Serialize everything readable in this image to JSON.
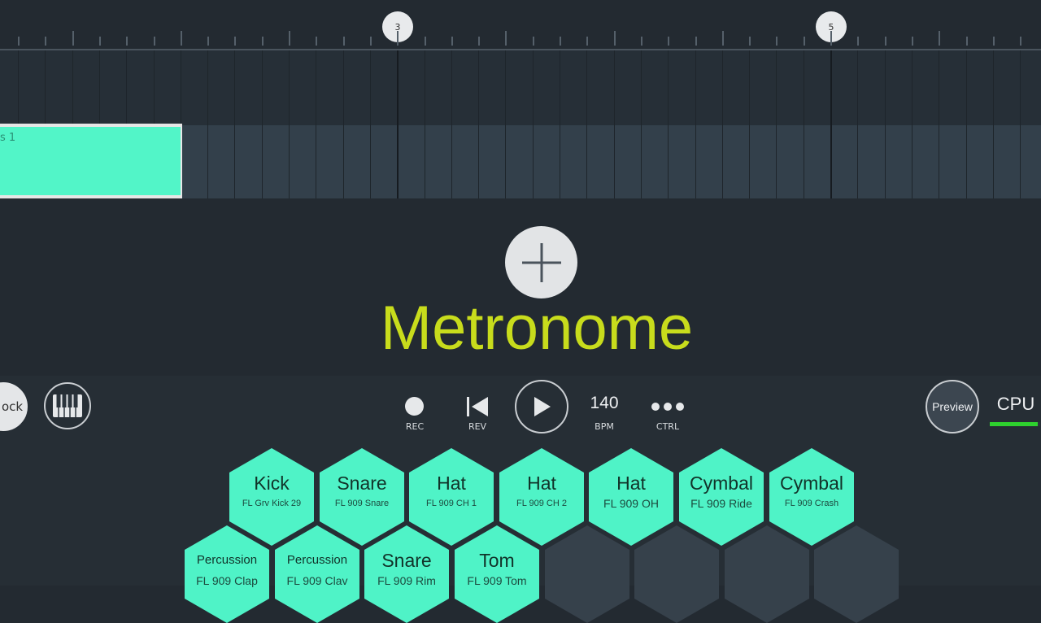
{
  "timeline": {
    "markers": [
      "3",
      "5"
    ]
  },
  "playlist": {
    "pattern_clip_label": "s 1"
  },
  "overlay": {
    "title": "Metronome"
  },
  "left_controls": {
    "lock_label": "ock"
  },
  "transport": {
    "rec_label": "REC",
    "rev_label": "REV",
    "bpm_value": "140",
    "bpm_label": "BPM",
    "ctrl_label": "CTRL"
  },
  "right_controls": {
    "preview_label": "Preview",
    "cpu_label": "CPU",
    "cpu_level": 0.95,
    "cpu_color": "#2ed12e"
  },
  "pads": {
    "row1": [
      {
        "name": "Kick",
        "sample": "FL Grv Kick 29"
      },
      {
        "name": "Snare",
        "sample": "FL 909 Snare"
      },
      {
        "name": "Hat",
        "sample": "FL 909 CH 1"
      },
      {
        "name": "Hat",
        "sample": "FL 909 CH 2"
      },
      {
        "name": "Hat",
        "sample": "FL 909 OH"
      },
      {
        "name": "Cymbal",
        "sample": "FL 909 Ride"
      },
      {
        "name": "Cymbal",
        "sample": "FL 909 Crash"
      }
    ],
    "row2": [
      {
        "name": "Percussion",
        "sample": "FL 909 Clap"
      },
      {
        "name": "Percussion",
        "sample": "FL 909 Clav"
      },
      {
        "name": "Snare",
        "sample": "FL 909 Rim"
      },
      {
        "name": "Tom",
        "sample": "FL 909 Tom"
      }
    ]
  },
  "colors": {
    "accent": "#4ff3c7",
    "title": "#c8dc1c"
  }
}
